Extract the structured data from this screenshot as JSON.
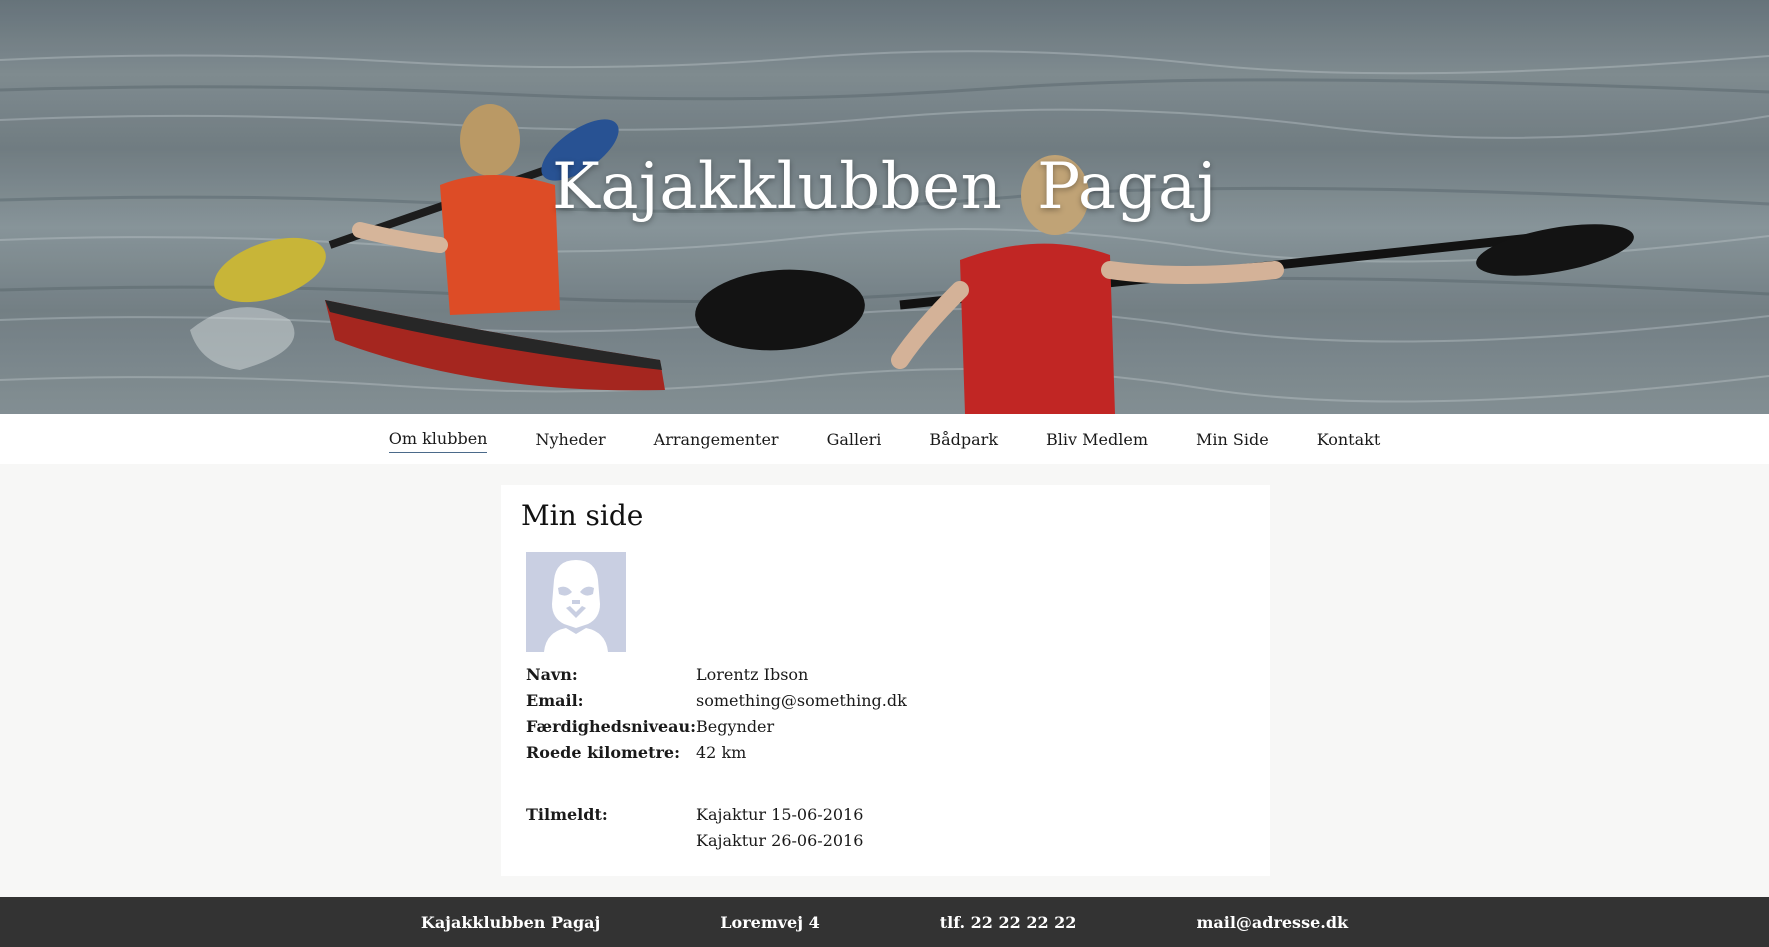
{
  "header": {
    "site_title": "Kajakklubben  Pagaj"
  },
  "nav": {
    "items": [
      {
        "label": "Om klubben"
      },
      {
        "label": "Nyheder"
      },
      {
        "label": "Arrangementer"
      },
      {
        "label": "Galleri"
      },
      {
        "label": "Bådpark"
      },
      {
        "label": "Bliv Medlem"
      },
      {
        "label": "Min Side"
      },
      {
        "label": "Kontakt"
      }
    ],
    "active_index": 0
  },
  "profile": {
    "title": "Min side",
    "avatar_icon": "stormtrooper-avatar-icon",
    "fields": [
      {
        "label": "Navn:",
        "value": "Lorentz Ibson"
      },
      {
        "label": "Email:",
        "value": "something@something.dk"
      },
      {
        "label": "Færdighedsniveau:",
        "value": "Begynder"
      },
      {
        "label": "Roede kilometre:",
        "value": "42 km"
      }
    ],
    "registered_label": "Tilmeldt:",
    "registered": [
      "Kajaktur 15-06-2016",
      "Kajaktur 26-06-2016"
    ]
  },
  "footer": {
    "club_name": "Kajakklubben Pagaj",
    "address": "Loremvej 4",
    "phone": "tlf. 22 22 22 22",
    "email": "mail@adresse.dk"
  },
  "colors": {
    "footer_bg": "#333333",
    "avatar_bg": "#c9cfe2",
    "page_bg": "#f7f7f6",
    "nav_active_underline": "#4b6a8a"
  }
}
